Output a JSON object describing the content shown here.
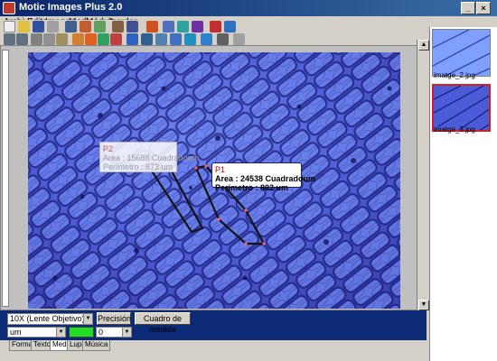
{
  "window": {
    "title": "Motic Images Plus 2.0"
  },
  "menu": [
    "Archivo",
    "Editar",
    "Imagen",
    "Medir",
    "Módulo",
    "Ayudar"
  ],
  "annotations": {
    "p1": {
      "label": "P1",
      "area": "Area : 24538 Cuadradoum",
      "perimeter": "Perímetro : 802 um"
    },
    "p2": {
      "label": "P2",
      "area": "Area : 15688 Cuadradoum",
      "perimeter": "Perímetro : 673 um"
    }
  },
  "thumbnails": [
    {
      "label": "imatge_2.jpg",
      "selected": false
    },
    {
      "label": "imatge_3.jpg",
      "selected": true
    }
  ],
  "bottom_panel": {
    "objective": "10X (Lente Objetivo)",
    "precision_label": "Precisión",
    "measure_frame_label": "Cuadro de medida",
    "unit": "um",
    "decimals": "0",
    "swatch_color": "#22dd22"
  },
  "tabs": [
    "Forma",
    "Texto",
    "Medir",
    "Lupa",
    "Música"
  ],
  "active_tab": "Medir",
  "colors": {
    "title_bar": "#0a246a",
    "panel_band": "#0d2a76",
    "cells": "#5566e0"
  }
}
